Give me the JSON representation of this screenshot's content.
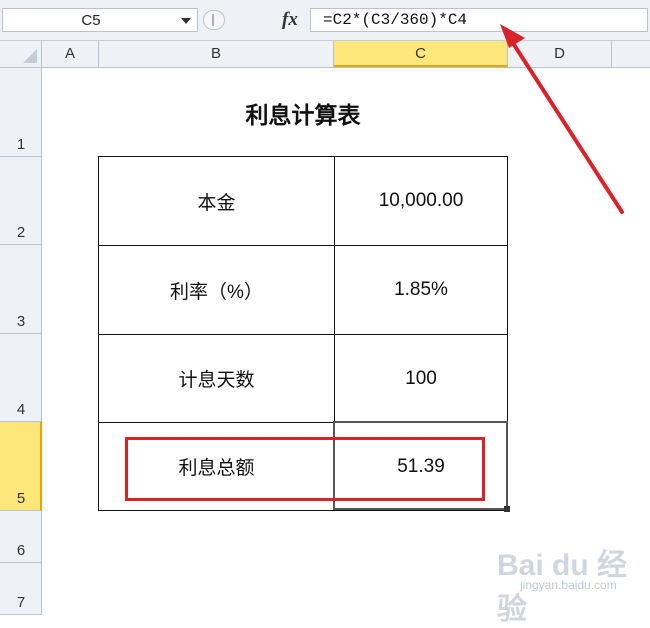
{
  "formula_bar": {
    "name_box": "C5",
    "fx_label": "fx",
    "formula": "=C2*(C3/360)*C4"
  },
  "columns": [
    "A",
    "B",
    "C",
    "D"
  ],
  "rows": [
    "1",
    "2",
    "3",
    "4",
    "5",
    "6",
    "7"
  ],
  "sheet": {
    "title": "利息计算表",
    "table": [
      {
        "label": "本金",
        "value": "10,000.00"
      },
      {
        "label": "利率（%）",
        "value": "1.85%"
      },
      {
        "label": "计息天数",
        "value": "100"
      },
      {
        "label": "利息总额",
        "value": "51.39"
      }
    ]
  },
  "watermark": {
    "logo": "Bai du 经验",
    "url": "jingyan.baidu.com"
  },
  "colors": {
    "header_bg": "#eef1f6",
    "active_header": "#fde67a",
    "annotation_red": "#d9232b"
  }
}
